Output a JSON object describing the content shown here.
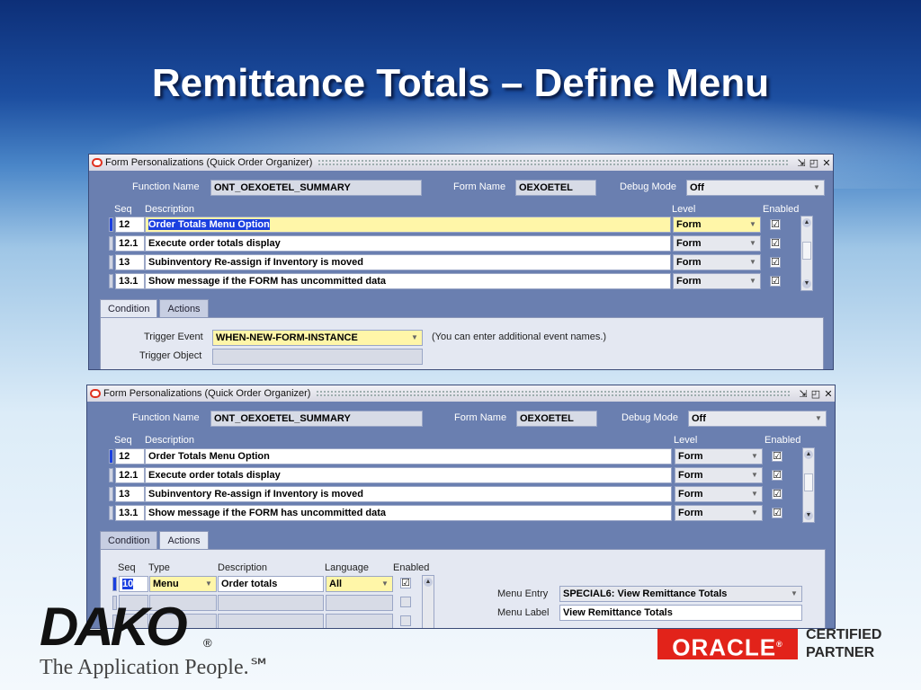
{
  "slide": {
    "title": "Remittance Totals – Define Menu"
  },
  "window1": {
    "title": "Form Personalizations (Quick Order Organizer)",
    "function_name_label": "Function Name",
    "function_name": "ONT_OEXOETEL_SUMMARY",
    "form_name_label": "Form Name",
    "form_name": "OEXOETEL",
    "debug_mode_label": "Debug Mode",
    "debug_mode": "Off",
    "col_seq": "Seq",
    "col_description": "Description",
    "col_level": "Level",
    "col_enabled": "Enabled",
    "rows": [
      {
        "seq": "12",
        "description": "Order Totals Menu Option",
        "level": "Form",
        "enabled": "☑"
      },
      {
        "seq": "12.1",
        "description": "Execute order totals display",
        "level": "Form",
        "enabled": "☑"
      },
      {
        "seq": "13",
        "description": "Subinventory Re-assign if Inventory is  moved",
        "level": "Form",
        "enabled": "☑"
      },
      {
        "seq": "13.1",
        "description": "Show message if the FORM has uncommitted data",
        "level": "Form",
        "enabled": "☑"
      }
    ],
    "tabs": [
      "Condition",
      "Actions"
    ],
    "trigger_event_label": "Trigger Event",
    "trigger_event": "WHEN-NEW-FORM-INSTANCE",
    "trigger_event_hint": "(You can enter additional event names.)",
    "trigger_object_label": "Trigger Object",
    "trigger_object": ""
  },
  "window2": {
    "title": "Form Personalizations (Quick Order Organizer)",
    "function_name_label": "Function Name",
    "function_name": "ONT_OEXOETEL_SUMMARY",
    "form_name_label": "Form Name",
    "form_name": "OEXOETEL",
    "debug_mode_label": "Debug Mode",
    "debug_mode": "Off",
    "col_seq": "Seq",
    "col_description": "Description",
    "col_level": "Level",
    "col_enabled": "Enabled",
    "rows": [
      {
        "seq": "12",
        "description": "Order Totals Menu Option",
        "level": "Form",
        "enabled": "☑"
      },
      {
        "seq": "12.1",
        "description": "Execute order totals display",
        "level": "Form",
        "enabled": "☑"
      },
      {
        "seq": "13",
        "description": "Subinventory Re-assign if Inventory is  moved",
        "level": "Form",
        "enabled": "☑"
      },
      {
        "seq": "13.1",
        "description": "Show message if the FORM has uncommitted data",
        "level": "Form",
        "enabled": "☑"
      }
    ],
    "tabs": [
      "Condition",
      "Actions"
    ],
    "actions": {
      "col_seq": "Seq",
      "col_type": "Type",
      "col_description": "Description",
      "col_language": "Language",
      "col_enabled": "Enabled",
      "row": {
        "seq": "10",
        "type": "Menu",
        "description": "Order totals",
        "language": "All",
        "enabled": "☑"
      }
    },
    "menu_entry_label": "Menu Entry",
    "menu_entry": "SPECIAL6: View Remittance Totals",
    "menu_label_label": "Menu Label",
    "menu_label": "View Remittance Totals"
  },
  "branding": {
    "dako": "DAKO",
    "registered": "®",
    "tagline": "The Application People.℠",
    "oracle": "ORACLE",
    "oracle_reg": "®",
    "certified": "CERTIFIED",
    "partner": "PARTNER"
  }
}
